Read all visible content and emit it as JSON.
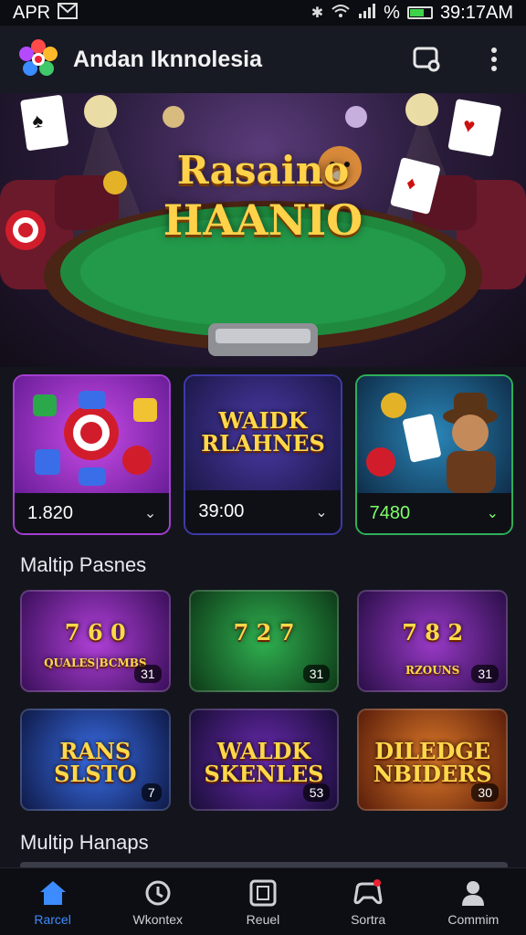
{
  "status_bar": {
    "carrier": "APR",
    "percent": "%",
    "time": "39:17AM",
    "battery_level": 0.7
  },
  "app_bar": {
    "title": "Andan Iknnolesia"
  },
  "hero": {
    "title_line1": "Rasaino",
    "title_line2": "HAANIO"
  },
  "featured": [
    {
      "value": "1.820",
      "accent": "#ffffff"
    },
    {
      "title": "WAIDK RLAHNES",
      "value": "39:00",
      "accent": "#ffffff"
    },
    {
      "value": "7480",
      "accent": "#7fff6a"
    }
  ],
  "sections": [
    {
      "title": "Maltip Pasnes",
      "tiles": [
        {
          "title": "7 6 0",
          "subtitle": "QUALES|BCMBS",
          "count": "31"
        },
        {
          "title": "7 2 7",
          "subtitle": "",
          "count": "31"
        },
        {
          "title": "7 8 2",
          "subtitle": "RZOUNS",
          "count": "31"
        }
      ]
    },
    {
      "title": "",
      "tiles": [
        {
          "title": "RANS SLSTO",
          "subtitle": "",
          "count": "7"
        },
        {
          "title": "WALDK SKENLES",
          "subtitle": "",
          "count": "53"
        },
        {
          "title": "DILEDGE NBIDERS",
          "subtitle": "",
          "count": "30"
        }
      ]
    },
    {
      "title": "Multip Hanaps"
    }
  ],
  "bottom_nav": [
    {
      "label": "Rarcel",
      "icon": "home-icon"
    },
    {
      "label": "Wkontex",
      "icon": "clock-icon"
    },
    {
      "label": "Reuel",
      "icon": "cards-icon"
    },
    {
      "label": "Sortra",
      "icon": "controller-icon"
    },
    {
      "label": "Commim",
      "icon": "profile-icon"
    }
  ],
  "colors": {
    "accent": "#3c8cff",
    "gold": "#ffd24a",
    "felt": "#1f8a3e"
  }
}
